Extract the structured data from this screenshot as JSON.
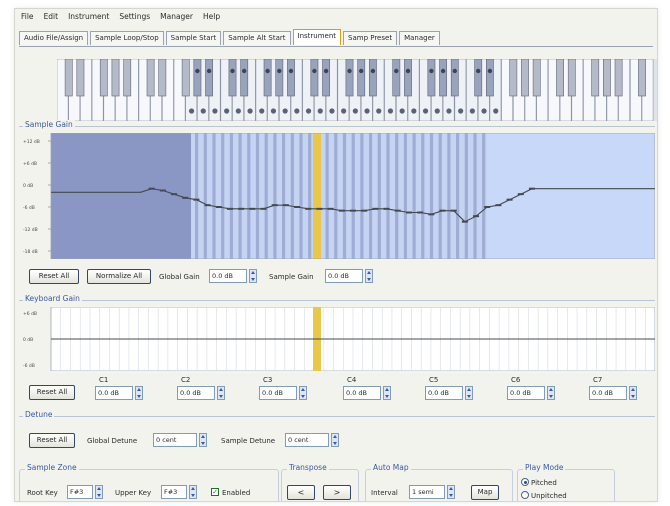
{
  "menu": [
    "File",
    "Edit",
    "Instrument",
    "Settings",
    "Manager",
    "Help"
  ],
  "tabs": [
    {
      "label": "Audio File/Assign",
      "active": false
    },
    {
      "label": "Sample Loop/Stop",
      "active": false
    },
    {
      "label": "Sample Start",
      "active": false
    },
    {
      "label": "Sample Alt Start",
      "active": false
    },
    {
      "label": "Instrument",
      "active": true
    },
    {
      "label": "Samp Preset",
      "active": false
    },
    {
      "label": "Manager",
      "active": false
    }
  ],
  "colors": {
    "selected_key": "#e8c84a",
    "inactive_region": "#8a96c4",
    "active_region": "#c6d4f4",
    "out_region": "#c8d8f8",
    "curve": "#44484f"
  },
  "sample_gain": {
    "title": "Sample Gain",
    "y_ticks": [
      "+12 dB",
      "+6 dB",
      "0 dB",
      "-6 dB",
      "-12 dB",
      "-18 dB"
    ],
    "curve_db": [
      -2,
      -2,
      -2,
      -2,
      -2,
      -2,
      -2,
      -2,
      -2,
      -1,
      -1.5,
      -2.5,
      -3.5,
      -4,
      -5.5,
      -6,
      -6.5,
      -6.5,
      -6.5,
      -6.5,
      -5.5,
      -5.5,
      -6,
      -6.5,
      -6.5,
      -6.5,
      -7,
      -7,
      -7,
      -6.5,
      -6.5,
      -7,
      -7.5,
      -7.5,
      -8,
      -7,
      -7,
      -10,
      -8.5,
      -6,
      -5.5,
      -4,
      -2.5,
      -1,
      -1,
      -1,
      -1,
      -1,
      -1,
      -1,
      -1,
      -1,
      -1,
      -1,
      -1
    ],
    "reset_label": "Reset All",
    "normalize_label": "Normalize All",
    "global_gain_label": "Global Gain",
    "global_gain_value": "0.0 dB",
    "sample_gain_label": "Sample Gain",
    "sample_gain_value": "0.0 dB"
  },
  "keyboard_gain": {
    "title": "Keyboard Gain",
    "y_ticks": [
      "+6 dB",
      "0 dB",
      "-6 dB"
    ],
    "reset_label": "Reset All",
    "octaves": [
      {
        "label": "C1",
        "value": "0.0 dB"
      },
      {
        "label": "C2",
        "value": "0.0 dB"
      },
      {
        "label": "C3",
        "value": "0.0 dB"
      },
      {
        "label": "C4",
        "value": "0.0 dB"
      },
      {
        "label": "C5",
        "value": "0.0 dB"
      },
      {
        "label": "C6",
        "value": "0.0 dB"
      },
      {
        "label": "C7",
        "value": "0.0 dB"
      }
    ]
  },
  "detune": {
    "title": "Detune",
    "reset_label": "Reset All",
    "global_label": "Global Detune",
    "global_value": "0 cent",
    "sample_label": "Sample Detune",
    "sample_value": "0 cent"
  },
  "sample_zone": {
    "title": "Sample Zone",
    "root_label": "Root Key",
    "root_value": "F#3",
    "upper_label": "Upper Key",
    "upper_value": "F#3",
    "enabled_label": "Enabled",
    "enabled": true
  },
  "transpose": {
    "title": "Transpose",
    "left": "<",
    "right": ">"
  },
  "auto_map": {
    "title": "Auto Map",
    "interval_label": "Interval",
    "interval_value": "1 semi",
    "map_label": "Map"
  },
  "play_mode": {
    "title": "Play Mode",
    "options": [
      "Pitched",
      "Unpitched"
    ],
    "selected": "Pitched"
  }
}
